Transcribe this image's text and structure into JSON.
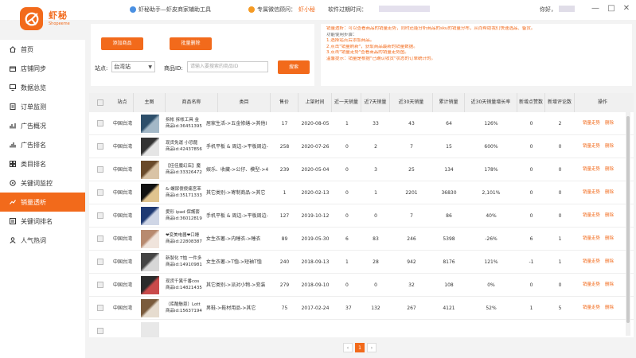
{
  "app": {
    "brand": "虾秘",
    "brand_sub": "Shopeeme",
    "tagline": "虾秘助手—虾皮商家辅助工具",
    "advisor_label": "专属微信顾问：",
    "advisor_name": "虾小秘",
    "expire_label": "软件过期时间：",
    "hello_label": "你好，"
  },
  "colors": {
    "accent": "#f26a1b",
    "tagline_icon": "#4a90e2",
    "advisor_icon": "#f59a23"
  },
  "window": {
    "minimize": "—",
    "maximize": "□",
    "close": "✕"
  },
  "nav": [
    {
      "label": "首页",
      "icon": "home-icon"
    },
    {
      "label": "店铺同步",
      "icon": "store-icon"
    },
    {
      "label": "数据总览",
      "icon": "monitor-icon"
    },
    {
      "label": "订单监测",
      "icon": "order-icon"
    },
    {
      "label": "广告概况",
      "icon": "ad-icon"
    },
    {
      "label": "广告排名",
      "icon": "ad-rank-icon"
    },
    {
      "label": "类目排名",
      "icon": "category-icon"
    },
    {
      "label": "关键词监控",
      "icon": "keyword-monitor-icon"
    },
    {
      "label": "销量透析",
      "icon": "sales-icon",
      "active": true
    },
    {
      "label": "关键词排名",
      "icon": "keyword-rank-icon"
    },
    {
      "label": "人气热词",
      "icon": "hot-word-icon"
    }
  ],
  "toolbar": {
    "add_label": "添加商品",
    "batch_delete_label": "批量删除",
    "site_label": "站点:",
    "site_value": "台湾站",
    "product_id_label": "商品ID:",
    "product_id_placeholder": "请输入要搜索的商品ID",
    "search_label": "搜索"
  },
  "info": {
    "lines": [
      "销量透析：可以查看商品的销量走势，同时还能分析商品的sku的销量分布，从而帮助我们快速选品、备货。",
      "功能使用步骤：",
      "1.选择站点后添加商品。",
      "2.点击\"销量刷新\"，获取商品最新的销量数据。",
      "3.点击\"销量走势\"查看商品的销量走势图。",
      "温馨提示：销量是根据\"已确认收货\"状态的订单统计的。"
    ]
  },
  "table": {
    "headers": [
      "站点",
      "主图",
      "商品名称",
      "类目",
      "售价",
      "上架时间",
      "近一天销量",
      "近7天销量",
      "近30天销量",
      "累计销量",
      "近30天销量增长率",
      "新增点赞数",
      "新增评论数",
      "操作"
    ],
    "op_trend": "销量走势",
    "op_delete": "删除",
    "rows": [
      {
        "site": "中国台湾",
        "name": "拆帐 拆帐工具 金",
        "pid": "商品id:36451395",
        "category": "居家生活->五金修缮->其他I",
        "price": "17",
        "date": "2020-08-05",
        "d1": "1",
        "d7": "33",
        "d30": "43",
        "total": "64",
        "growth": "126%",
        "likes": "0",
        "comments": "2"
      },
      {
        "site": "中国台湾",
        "name": "现货免運 小恐龍",
        "pid": "商品id:42437856",
        "category": "手机平板 & 周边->平板周边-",
        "price": "258",
        "date": "2020-07-26",
        "d1": "0",
        "d7": "2",
        "d30": "7",
        "total": "15",
        "growth": "600%",
        "likes": "0",
        "comments": "0"
      },
      {
        "site": "中国台湾",
        "name": "【佳佳魔幻店】魔",
        "pid": "商品id:33326472",
        "category": "娱乐、收藏->公仔、模型->4",
        "price": "239",
        "date": "2020-05-04",
        "d1": "0",
        "d7": "3",
        "d30": "25",
        "total": "134",
        "growth": "178%",
        "likes": "0",
        "comments": "0"
      },
      {
        "site": "中国台湾",
        "name": "&-螺尿傻傻痛宮苯",
        "pid": "商品id:35171333",
        "category": "其它类别->寄制商品->其它",
        "price": "1",
        "date": "2020-02-13",
        "d1": "0",
        "d7": "1",
        "d30": "2201",
        "total": "36830",
        "growth": "2,101%",
        "likes": "0",
        "comments": "0"
      },
      {
        "site": "中国台湾",
        "name": "愛形 ipad 保護套",
        "pid": "商品id:36012819",
        "category": "手机平板 & 周边->平板周边-",
        "price": "127",
        "date": "2019-10-12",
        "d1": "0",
        "d7": "0",
        "d30": "7",
        "total": "86",
        "growth": "40%",
        "likes": "0",
        "comments": "0"
      },
      {
        "site": "中国台湾",
        "name": "❤变美电器❤口睡",
        "pid": "商品id:22808387",
        "category": "女生衣著->内睡衣->睡衣",
        "price": "89",
        "date": "2019-05-30",
        "d1": "6",
        "d7": "83",
        "d30": "246",
        "total": "5398",
        "growth": "-26%",
        "likes": "6",
        "comments": "1"
      },
      {
        "site": "中国台湾",
        "name": "新製化 T恤 一件多",
        "pid": "商品id:14910981",
        "category": "女生衣著->T恤->短袖T恤",
        "price": "240",
        "date": "2018-09-13",
        "d1": "1",
        "d7": "28",
        "d30": "942",
        "total": "8176",
        "growth": "121%",
        "likes": "-1",
        "comments": "1"
      },
      {
        "site": "中国台湾",
        "name": "现货千異千番cos",
        "pid": "商品id:14821435",
        "category": "其它类别->派对小物->变装",
        "price": "279",
        "date": "2018-09-10",
        "d1": "0",
        "d7": "0",
        "d30": "32",
        "total": "108",
        "growth": "0%",
        "likes": "0",
        "comments": "0"
      },
      {
        "site": "中国台湾",
        "name": "（库酷魅恩）Lott",
        "pid": "商品id:15637194",
        "category": "男鞋->鞋材用品->其它",
        "price": "75",
        "date": "2017-02-24",
        "d1": "37",
        "d7": "132",
        "d30": "267",
        "total": "4121",
        "growth": "52%",
        "likes": "1",
        "comments": "5"
      }
    ]
  },
  "pagination": {
    "prev": "‹",
    "current": "1",
    "next": "›"
  }
}
